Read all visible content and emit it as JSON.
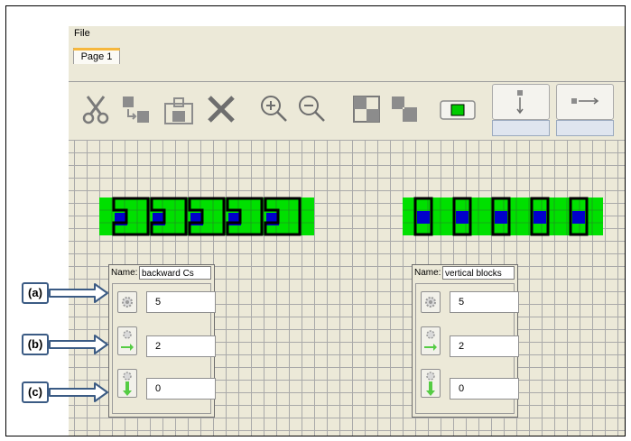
{
  "menu": {
    "file": "File"
  },
  "tabs": [
    {
      "label": "Page 1"
    }
  ],
  "toolbar": {
    "icons": [
      "scissors-icon",
      "copy-icon",
      "paste-icon",
      "delete-icon",
      "zoom-in-icon",
      "zoom-out-icon",
      "group-icon",
      "ungroup-icon",
      "color-block-icon",
      "vertical-step-icon",
      "horizontal-step-icon"
    ],
    "accent_green": "#00cc00"
  },
  "canvas": {
    "block_green": "#00e000",
    "block_blue": "#0000cc"
  },
  "panels": [
    {
      "name_label": "Name:",
      "name_value": "backward Cs",
      "count": "5",
      "dx": "2",
      "dy": "0"
    },
    {
      "name_label": "Name:",
      "name_value": "vertical blocks",
      "count": "5",
      "dx": "2",
      "dy": "0"
    }
  ],
  "callouts": [
    "(a)",
    "(b)",
    "(c)"
  ]
}
